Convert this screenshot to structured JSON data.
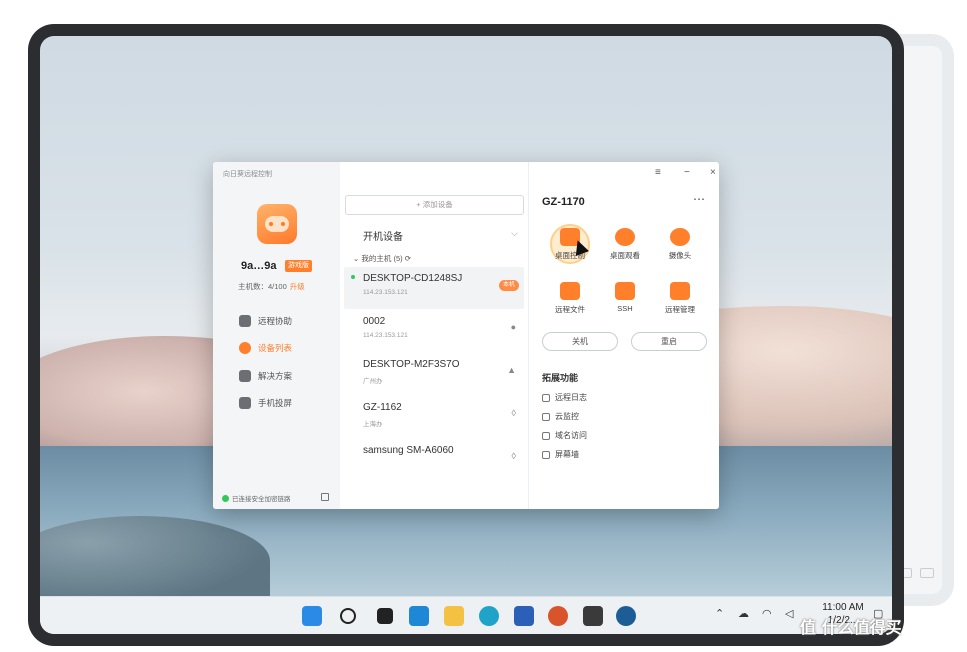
{
  "app": {
    "title": "向日葵远程控制",
    "user_name": "9a…9a",
    "badge": "游戏版",
    "host_count_label": "主机数：4/100",
    "upgrade": "升级",
    "secure_label": "已连接安全加密链路"
  },
  "sidebar": {
    "items": [
      {
        "label": "远程协助",
        "icon": "remote-assist-icon"
      },
      {
        "label": "设备列表",
        "icon": "device-list-icon",
        "active": true
      },
      {
        "label": "解决方案",
        "icon": "solutions-icon"
      },
      {
        "label": "手机投屏",
        "icon": "screen-cast-icon"
      }
    ]
  },
  "devices": {
    "add_button": "+ 添加设备",
    "boot_label": "开机设备",
    "group_label": "我的主机 (5)",
    "items": [
      {
        "name": "DESKTOP-CD1248SJ",
        "detail": "114.23.153.121",
        "tag": "本机",
        "online": true
      },
      {
        "name": "0002",
        "detail": "114.23.153.121",
        "os": ""
      },
      {
        "name": "DESKTOP-M2F3S7O",
        "detail": "广州办",
        "os": ""
      },
      {
        "name": "GZ-1162",
        "detail": "上海办",
        "os": ""
      },
      {
        "name": "samsung SM-A6060",
        "detail": "",
        "os": ""
      }
    ]
  },
  "detail": {
    "title": "GZ-1170",
    "more": "⋯",
    "actions": [
      {
        "label": "桌面控制",
        "icon": "desktop-control-icon"
      },
      {
        "label": "桌面观看",
        "icon": "desktop-view-icon"
      },
      {
        "label": "摄像头",
        "icon": "camera-icon"
      },
      {
        "label": "远程文件",
        "icon": "remote-files-icon"
      },
      {
        "label": "SSH",
        "icon": "ssh-icon"
      },
      {
        "label": "远程管理",
        "icon": "remote-manage-icon"
      }
    ],
    "power_off": "关机",
    "restart": "重启",
    "ext_title": "拓展功能",
    "ext_items": [
      {
        "label": "远程日志",
        "icon": "log-icon"
      },
      {
        "label": "云监控",
        "icon": "cloud-monitor-icon"
      },
      {
        "label": "域名访问",
        "icon": "domain-access-icon"
      },
      {
        "label": "屏幕墙",
        "icon": "screen-wall-icon"
      }
    ]
  },
  "window_controls": {
    "menu": "≡",
    "minimize": "−",
    "close": "×"
  },
  "taskbar": {
    "time": "11:00 AM",
    "date": "1/2/2..."
  },
  "watermark": "值 什么值得买"
}
